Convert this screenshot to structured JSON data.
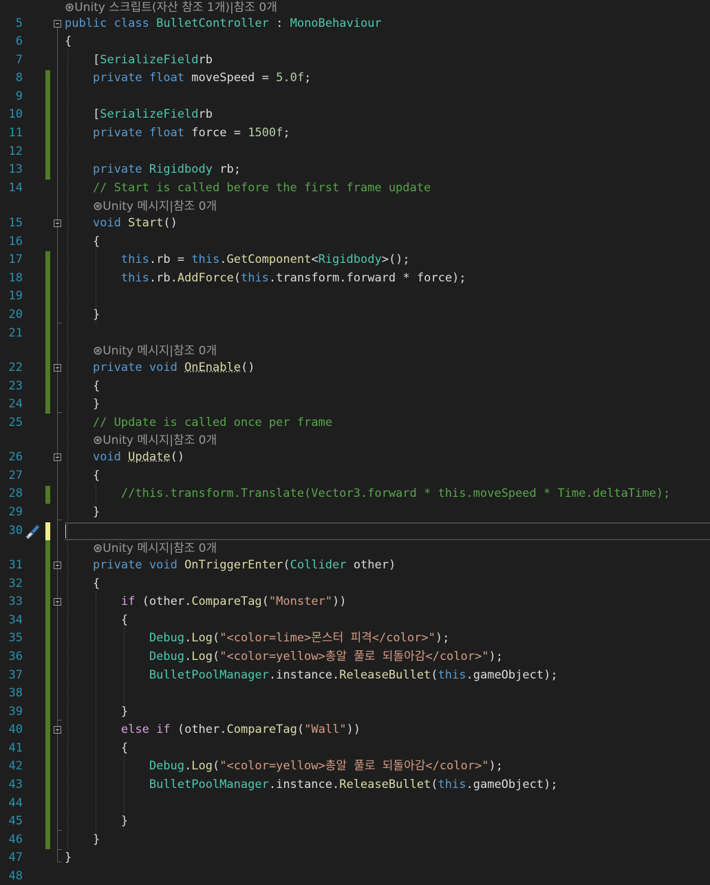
{
  "colors": {
    "background": "#1e1e1e",
    "line_number": "#2b91af",
    "keyword": "#569cd6",
    "type": "#4ec9b0",
    "comment": "#57a64a",
    "string": "#d69d85",
    "method": "#dcdcaa",
    "control": "#d8a0df",
    "number": "#b5cea8",
    "change_saved": "#4f7a28",
    "change_unsaved": "#efef91"
  },
  "lens": {
    "class_ref": "Unity 스크립트(자산 참조 1개)|참조 0개",
    "message_ref": "Unity 메시지|참조 0개",
    "icon": "unity-cube-icon"
  },
  "lines": {
    "n5": "5",
    "n6": "6",
    "n7": "7",
    "n8": "8",
    "n9": "9",
    "n10": "10",
    "n11": "11",
    "n12": "12",
    "n13": "13",
    "n14": "14",
    "n15": "15",
    "n16": "16",
    "n17": "17",
    "n18": "18",
    "n19": "19",
    "n20": "20",
    "n21": "21",
    "n22": "22",
    "n23": "23",
    "n24": "24",
    "n25": "25",
    "n26": "26",
    "n27": "27",
    "n28": "28",
    "n29": "29",
    "n30": "30",
    "n31": "31",
    "n32": "32",
    "n33": "33",
    "n34": "34",
    "n35": "35",
    "n36": "36",
    "n37": "37",
    "n38": "38",
    "n39": "39",
    "n40": "40",
    "n41": "41",
    "n42": "42",
    "n43": "43",
    "n44": "44",
    "n45": "45",
    "n46": "46",
    "n47": "47",
    "n48": "48"
  },
  "code": {
    "public": "public",
    "class": "class",
    "class_name": "BulletController",
    "colon": " : ",
    "base": "MonoBehaviour",
    "open": "{",
    "close": "}",
    "serialize": "SerializeField",
    "lb": "[",
    "rb": "rb",
    "private": "private",
    "float": "float",
    "movespeed": "moveSpeed",
    "eq": " = ",
    "five": "5.0f",
    "semi": ";",
    "force": "force",
    "f1500": "1500f",
    "rigidbody": "Rigidbody",
    "c14": "// Start is called before the first frame update",
    "void": "void",
    "start": "Start",
    "parens": "()",
    "this": "this",
    "dot_rb": ".rb",
    "dot": ".",
    "getcomponent": "GetComponent",
    "lt": "<",
    "gt": ">",
    "call_end": "();",
    "addforce": "AddForce",
    "paren_open": "(",
    "transform_forward": "transform.forward",
    "times": " * ",
    "force_end": "force);",
    "onenable": "OnEnable",
    "c25": "// Update is called once per frame",
    "update": "Update",
    "c28": "//this.transform.Translate(Vector3.forward * this.moveSpeed * Time.deltaTime);",
    "ontrigger": "OnTriggerEnter",
    "collider": "Collider",
    "other": "other",
    "close_paren": ")",
    "if": "if",
    "else": "else",
    "comparetag": "CompareTag",
    "monster": "\"Monster\"",
    "wall": "\"Wall\"",
    "dbl_close": "))",
    "debug": "Debug",
    "log": "Log",
    "s_lime": "\"<color=lime>몬스터 피격</color>\"",
    "s_yellow": "\"<color=yellow>총알 풀로 되돌아감</color>\"",
    "end_call": ");",
    "pool": "BulletPoolManager",
    "instance": "instance",
    "release": "ReleaseBullet",
    "gameobject": "gameObject);"
  }
}
